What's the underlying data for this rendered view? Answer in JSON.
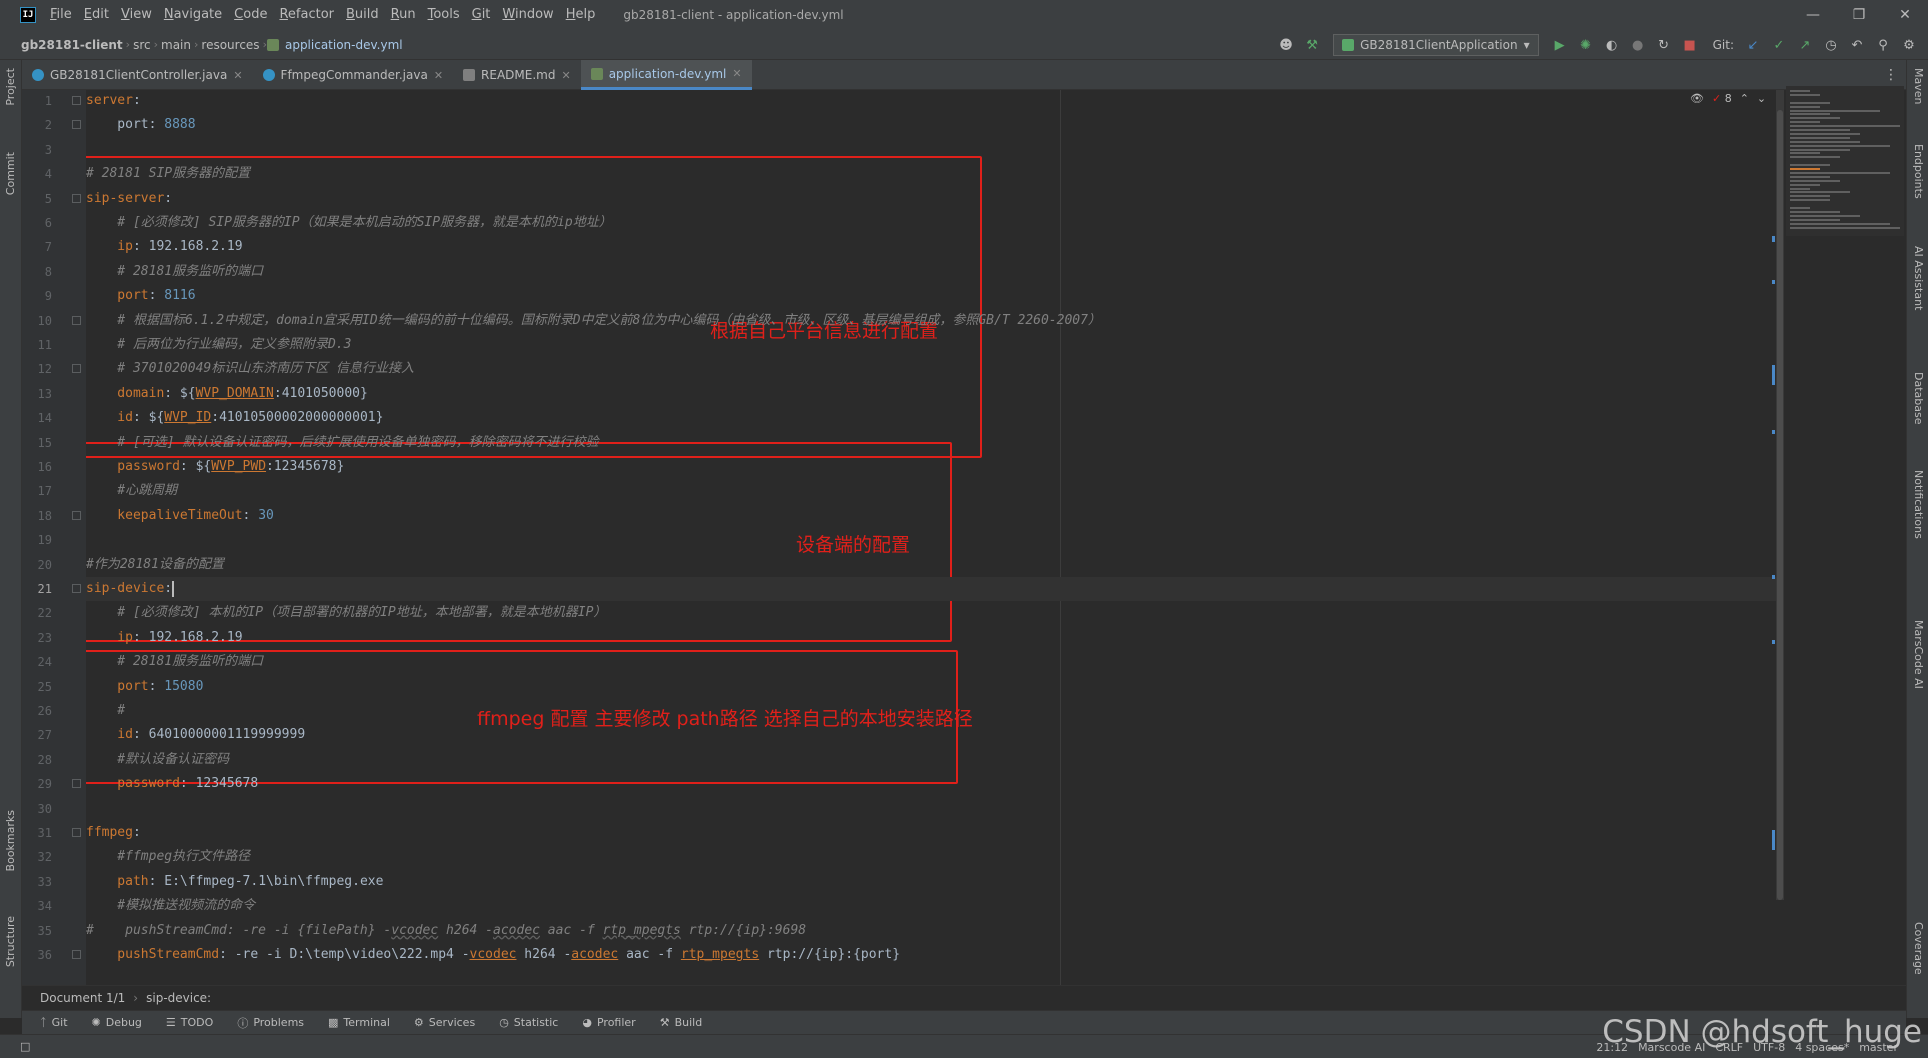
{
  "window": {
    "title": "gb28181-client - application-dev.yml",
    "logo": "IJ",
    "menu": [
      "File",
      "Edit",
      "View",
      "Navigate",
      "Code",
      "Refactor",
      "Build",
      "Run",
      "Tools",
      "Git",
      "Window",
      "Help"
    ]
  },
  "nav": {
    "breadcrumbs": [
      "gb28181-client",
      "src",
      "main",
      "resources",
      "application-dev.yml"
    ],
    "run_config": "GB28181ClientApplication",
    "git_label": "Git:"
  },
  "left_tools": [
    "Project",
    "Commit",
    "Bookmarks",
    "Structure"
  ],
  "right_tools": [
    "Maven",
    "Endpoints",
    "AI Assistant",
    "Database",
    "Notifications",
    "MarsCode AI",
    "Coverage"
  ],
  "tabs": [
    {
      "label": "GB28181ClientController.java",
      "kind": "java"
    },
    {
      "label": "FfmpegCommander.java",
      "kind": "java"
    },
    {
      "label": "README.md",
      "kind": "md"
    },
    {
      "label": "application-dev.yml",
      "kind": "yml",
      "active": true
    }
  ],
  "inspections": {
    "warnings": "8"
  },
  "code": [
    {
      "n": "1",
      "segs": [
        [
          "k",
          "server"
        ],
        [
          "v",
          ":"
        ]
      ]
    },
    {
      "n": "2",
      "segs": [
        [
          "v",
          "    port: "
        ],
        [
          "n",
          "8888"
        ]
      ]
    },
    {
      "n": "3",
      "segs": []
    },
    {
      "n": "4",
      "segs": [
        [
          "c",
          "# 28181 SIP服务器的配置"
        ]
      ]
    },
    {
      "n": "5",
      "segs": [
        [
          "k",
          "sip-server"
        ],
        [
          "v",
          ":"
        ]
      ]
    },
    {
      "n": "6",
      "segs": [
        [
          "c",
          "    # [必须修改] SIP服务器的IP（如果是本机启动的SIP服务器，就是本机的ip地址）"
        ]
      ]
    },
    {
      "n": "7",
      "segs": [
        [
          "k",
          "    ip"
        ],
        [
          "v",
          ": 192.168.2.19"
        ]
      ]
    },
    {
      "n": "8",
      "segs": [
        [
          "c",
          "    # 28181服务监听的端口"
        ]
      ]
    },
    {
      "n": "9",
      "segs": [
        [
          "k",
          "    port"
        ],
        [
          "v",
          ": "
        ],
        [
          "n",
          "8116"
        ]
      ]
    },
    {
      "n": "10",
      "segs": [
        [
          "c",
          "    # 根据国标6.1.2中规定，domain宜采用ID统一编码的前十位编码。国标附录D中定义前8位为中心编码（由省级、市级、区级、基层编号组成，参照GB/T 2260-2007）"
        ]
      ]
    },
    {
      "n": "11",
      "segs": [
        [
          "c",
          "    # 后两位为行业编码，定义参照附录D.3"
        ]
      ]
    },
    {
      "n": "12",
      "segs": [
        [
          "c",
          "    # 3701020049标识山东济南历下区 信息行业接入"
        ]
      ]
    },
    {
      "n": "13",
      "segs": [
        [
          "k",
          "    domain"
        ],
        [
          "v",
          ": ${"
        ],
        [
          "ph",
          "WVP_DOMAIN"
        ],
        [
          "v",
          ":4101050000}"
        ]
      ]
    },
    {
      "n": "14",
      "segs": [
        [
          "k",
          "    id"
        ],
        [
          "v",
          ": ${"
        ],
        [
          "ph",
          "WVP_ID"
        ],
        [
          "v",
          ":41010500002000000001}"
        ]
      ]
    },
    {
      "n": "15",
      "segs": [
        [
          "c",
          "    # [可选] 默认设备认证密码，后续扩展使用设备单独密码，移除密码将不进行校验"
        ]
      ]
    },
    {
      "n": "16",
      "segs": [
        [
          "k",
          "    password"
        ],
        [
          "v",
          ": ${"
        ],
        [
          "ph",
          "WVP_PWD"
        ],
        [
          "v",
          ":12345678}"
        ]
      ]
    },
    {
      "n": "17",
      "segs": [
        [
          "c",
          "    #心跳周期"
        ]
      ]
    },
    {
      "n": "18",
      "segs": [
        [
          "k",
          "    keepaliveTimeOut"
        ],
        [
          "v",
          ": "
        ],
        [
          "n",
          "30"
        ]
      ]
    },
    {
      "n": "19",
      "segs": []
    },
    {
      "n": "20",
      "segs": [
        [
          "c",
          "#作为28181设备的配置"
        ]
      ]
    },
    {
      "n": "21",
      "segs": [
        [
          "k",
          "sip-device"
        ],
        [
          "v",
          ":"
        ],
        [
          "caret",
          ""
        ]
      ],
      "current": true
    },
    {
      "n": "22",
      "segs": [
        [
          "c",
          "    # [必须修改] 本机的IP（项目部署的机器的IP地址，本地部署，就是本地机器IP）"
        ]
      ]
    },
    {
      "n": "23",
      "segs": [
        [
          "k",
          "    ip"
        ],
        [
          "v",
          ": 192.168.2.19"
        ]
      ]
    },
    {
      "n": "24",
      "segs": [
        [
          "c",
          "    # 28181服务监听的端口"
        ]
      ]
    },
    {
      "n": "25",
      "segs": [
        [
          "k",
          "    port"
        ],
        [
          "v",
          ": "
        ],
        [
          "n",
          "15080"
        ]
      ]
    },
    {
      "n": "26",
      "segs": [
        [
          "c",
          "    #"
        ]
      ]
    },
    {
      "n": "27",
      "segs": [
        [
          "k",
          "    id"
        ],
        [
          "v",
          ": 64010000001119999999"
        ]
      ]
    },
    {
      "n": "28",
      "segs": [
        [
          "c",
          "    #默认设备认证密码"
        ]
      ]
    },
    {
      "n": "29",
      "segs": [
        [
          "k",
          "    password"
        ],
        [
          "v",
          ": 12345678"
        ]
      ]
    },
    {
      "n": "30",
      "segs": []
    },
    {
      "n": "31",
      "segs": [
        [
          "k",
          "ffmpeg"
        ],
        [
          "v",
          ":"
        ]
      ]
    },
    {
      "n": "32",
      "segs": [
        [
          "c",
          "    #ffmpeg执行文件路径"
        ]
      ]
    },
    {
      "n": "33",
      "segs": [
        [
          "k",
          "    path"
        ],
        [
          "v",
          ": E:\\ffmpeg-7.1\\bin\\ffmpeg.exe"
        ]
      ]
    },
    {
      "n": "34",
      "segs": [
        [
          "c",
          "    #模拟推送视频流的命令"
        ]
      ]
    },
    {
      "n": "35",
      "segs": [
        [
          "c",
          "#    pushStreamCmd: -re -i {filePath} -"
        ],
        [
          "cu",
          "vcodec"
        ],
        [
          "c",
          " h264 -"
        ],
        [
          "cu",
          "acodec"
        ],
        [
          "c",
          " aac -f "
        ],
        [
          "cu",
          "rtp_mpegts"
        ],
        [
          "c",
          " rtp://{ip}:9698"
        ]
      ]
    },
    {
      "n": "36",
      "segs": [
        [
          "k",
          "    pushStreamCmd"
        ],
        [
          "v",
          ": -re -i D:\\temp\\video\\222.mp4 -"
        ],
        [
          "ph",
          "vcodec"
        ],
        [
          "v",
          " h264 -"
        ],
        [
          "ph",
          "acodec"
        ],
        [
          "v",
          " aac -f "
        ],
        [
          "ph",
          "rtp_mpegts"
        ],
        [
          "v",
          " rtp://{ip}:{port}"
        ]
      ]
    }
  ],
  "annotations": {
    "box1": "根据自己平台信息进行配置",
    "box2": "设备端的配置",
    "box3": "ffmpeg 配置  主要修改 path路径   选择自己的本地安装路径"
  },
  "breadcrumb_bar": {
    "doc": "Document 1/1",
    "path": "sip-device:"
  },
  "tool_windows": [
    "Git",
    "Debug",
    "TODO",
    "Problems",
    "Terminal",
    "Services",
    "Statistic",
    "Profiler",
    "Build"
  ],
  "status": {
    "position": "21:12",
    "ai": "Marscode AI",
    "line_sep": "CRLF",
    "encoding": "UTF-8",
    "indent": "4 spaces*",
    "branch": "master"
  },
  "watermark": "CSDN @hdsoft_huge",
  "colors": {
    "keyword": "#cc7832",
    "number": "#6897bb",
    "comment": "#808080",
    "annotation": "#e0201a",
    "accent": "#4a88c7"
  }
}
